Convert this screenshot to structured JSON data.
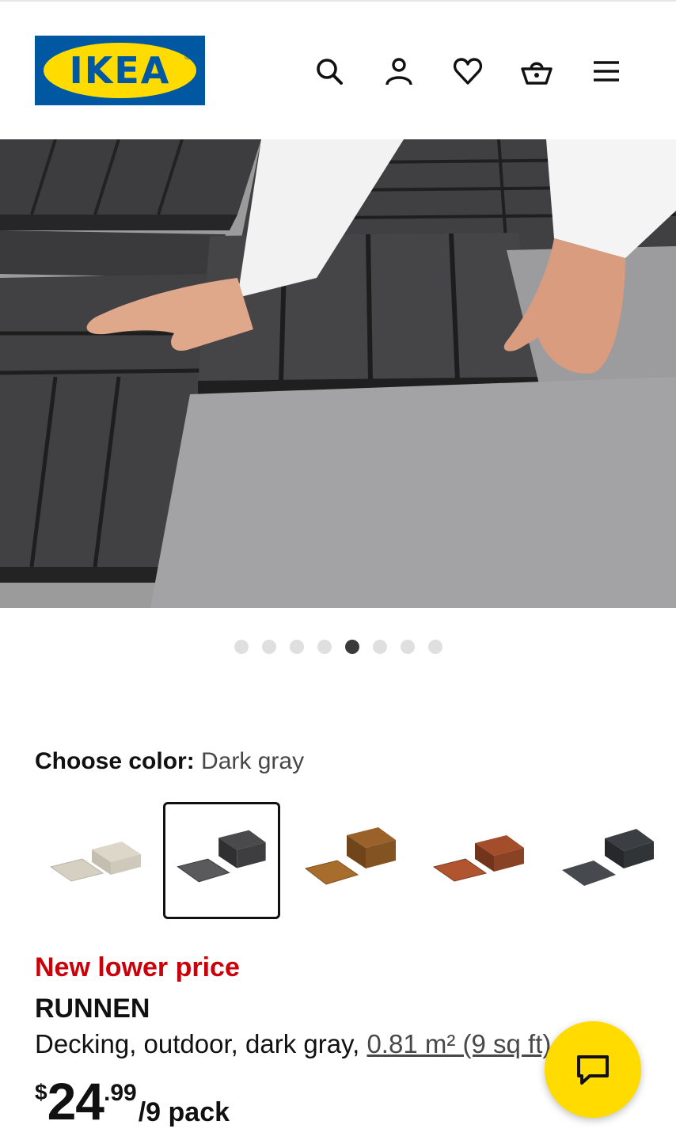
{
  "header": {
    "logo_text": "IKEA",
    "icons": [
      "search-icon",
      "account-icon",
      "favourites-icon",
      "shopping-bag-icon",
      "menu-icon"
    ]
  },
  "gallery": {
    "total_images": 8,
    "active_index": 5
  },
  "color_chooser": {
    "label": "Choose color:",
    "selected": "Dark gray",
    "options": [
      {
        "name": "Light gray-beige",
        "color": "#d3cdc0",
        "selected": false
      },
      {
        "name": "Dark gray",
        "color": "#4a4a4c",
        "selected": true
      },
      {
        "name": "Light brown",
        "color": "#9e6a2e",
        "selected": false
      },
      {
        "name": "Brown",
        "color": "#a5502e",
        "selected": false
      },
      {
        "name": "Anthracite",
        "color": "#3b3e42",
        "selected": false
      }
    ]
  },
  "product": {
    "promo": "New lower price",
    "name": "RUNNEN",
    "description": "Decking, outdoor, dark gray, ",
    "measurement": "0.81 m² (9 sq ft)",
    "price_currency": "$",
    "price_integer": "24",
    "price_decimal": ".99",
    "price_unit": "/9 pack"
  },
  "colors": {
    "ikea_blue": "#0058a3",
    "ikea_yellow": "#ffdb00",
    "promo_red": "#cc0008"
  },
  "chat": {
    "icon": "chat-icon"
  }
}
